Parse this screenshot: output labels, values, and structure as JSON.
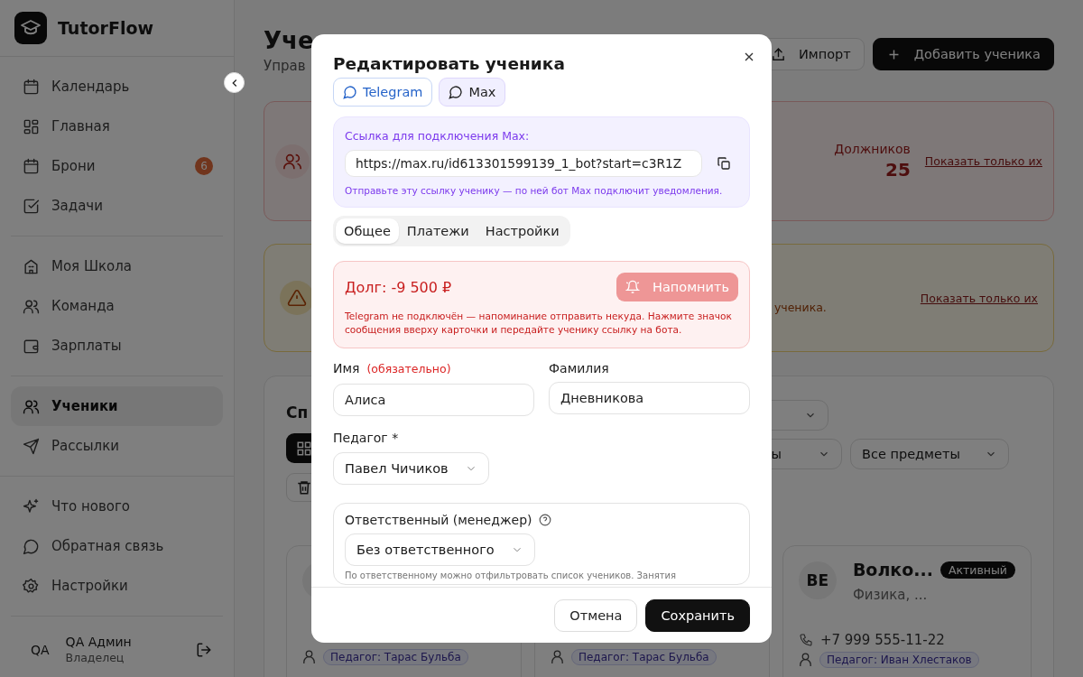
{
  "app": {
    "name": "TutorFlow"
  },
  "sidebar": {
    "groups": [
      [
        {
          "label": "Календарь",
          "selected": false
        },
        {
          "label": "Главная",
          "selected": false
        },
        {
          "label": "Брони",
          "selected": false,
          "badge": "6"
        },
        {
          "label": "Задачи",
          "selected": false
        }
      ],
      [
        {
          "label": "Моя Школа",
          "selected": false
        },
        {
          "label": "Команда",
          "selected": false
        },
        {
          "label": "Зарплаты",
          "selected": false
        }
      ],
      [
        {
          "label": "Ученики",
          "selected": true
        },
        {
          "label": "Рассылки",
          "selected": false
        }
      ],
      [
        {
          "label": "Что нового",
          "selected": false
        },
        {
          "label": "Обратная связь",
          "selected": false
        },
        {
          "label": "Настройки",
          "selected": false
        }
      ]
    ],
    "user": {
      "initials": "QA",
      "name": "QA Админ",
      "role": "Владелец"
    }
  },
  "page": {
    "title": "Уче",
    "subtitle": "Управ",
    "actions": [
      {
        "label": "Импорт",
        "kind": "secondary"
      },
      {
        "label": "Добавить ученика",
        "kind": "primary"
      }
    ]
  },
  "alerts": [
    {
      "kind": "debt",
      "label": "Должников",
      "count": "25",
      "link": "Показать только их"
    },
    {
      "kind": "warning",
      "text": "ученика.",
      "link": "Показать только их"
    }
  ],
  "student_list": {
    "title": "Сп",
    "filters": [
      {
        "value": "ы"
      },
      {
        "value": "Все предметы"
      }
    ],
    "students": [
      {
        "teacher": "Педагог: Тарас Бульба"
      },
      {
        "teacher": "Педагог: Тарас Бульба"
      },
      {
        "initials": "ВЕ",
        "name": "Волко...",
        "status": "Активный",
        "subjects": "Физика, ...",
        "phone": "+7 999 555-11-22",
        "teacher": "Педагог: Иван Хлестаков"
      }
    ]
  },
  "modal": {
    "title": "Редактировать ученика",
    "messengers": [
      {
        "label": "Telegram",
        "selected": false
      },
      {
        "label": "Max",
        "selected": true
      }
    ],
    "link_panel": {
      "label": "Ссылка для подключения Max:",
      "url": "https://max.ru/id613301599139_1_bot?start=c3R1Z",
      "hint": "Отправьте эту ссылку ученику — по ней бот Max подключит уведомления."
    },
    "tabs": [
      {
        "label": "Общее",
        "selected": true
      },
      {
        "label": "Платежи",
        "selected": false
      },
      {
        "label": "Настройки",
        "selected": false
      }
    ],
    "debt": {
      "title": "Долг: -9 500 ₽",
      "button": "Напомнить",
      "button_disabled": true,
      "message": "Telegram не подключён — напоминание отправить некуда. Нажмите значок сообщения вверху карточки и передайте ученику ссылку на бота."
    },
    "first_name": {
      "label": "Имя",
      "required_note": "(обязательно)",
      "value": "Алиса"
    },
    "last_name": {
      "label": "Фамилия",
      "value": "Дневникова"
    },
    "teacher": {
      "label": "Педагог *",
      "value": "Павел Чичиков"
    },
    "manager": {
      "label": "Ответственный (менеджер)",
      "value": "Без ответственного",
      "hint": "По ответственному можно отфильтровать список учеников. Занятия"
    },
    "buttons": [
      {
        "label": "Отмена",
        "kind": "secondary"
      },
      {
        "label": "Сохранить",
        "kind": "primary"
      }
    ]
  }
}
